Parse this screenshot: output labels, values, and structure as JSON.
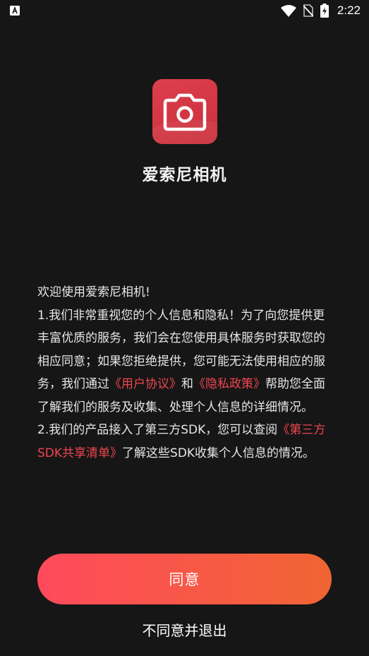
{
  "status_bar": {
    "time": "2:22",
    "icons": [
      "notification-a-icon",
      "wifi-icon",
      "no-sim-icon",
      "battery-charging-icon"
    ]
  },
  "app": {
    "name": "爱索尼相机",
    "icon": "camera-icon",
    "icon_color": "#d13743"
  },
  "agreement": {
    "line1": "欢迎使用爱索尼相机!",
    "p1_part1": "1.我们非常重视您的个人信息和隐私！为了向您提供更丰富优质的服务，我们会在您使用具体服务时获取您的相应同意；如果您拒绝提供，您可能无法使用相应的服务，我们通过",
    "user_agreement_link": "《用户协议》",
    "p1_and": "和",
    "privacy_policy_link": "《隐私政策》",
    "p1_part2": "帮助您全面了解我们的服务及收集、处理个人信息的详细情况。",
    "p2_part1": "2.我们的产品接入了第三方SDK，您可以查阅",
    "sdk_list_link": "《第三方SDK共享清单》",
    "p2_part2": "了解这些SDK收集个人信息的情况。",
    "link_color": "#f0454f"
  },
  "buttons": {
    "agree_label": "同意",
    "disagree_label": "不同意并退出"
  },
  "colors": {
    "background": "#161616",
    "agree_gradient_start": "#ff4a5c",
    "agree_gradient_end": "#f06533"
  }
}
